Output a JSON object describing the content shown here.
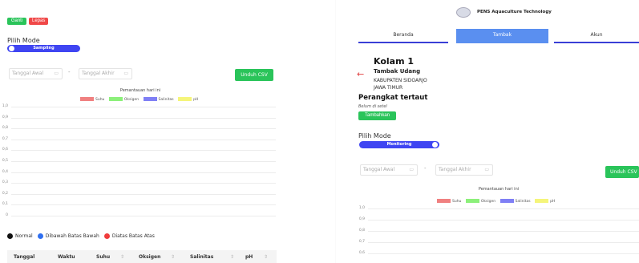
{
  "left": {
    "buttons": {
      "ganti": "Ganti",
      "lepas": "Lepas"
    },
    "mode_label": "Pilih Mode",
    "mode_toggle": "Sampling",
    "date_start": "Tanggal Awal",
    "date_end": "Tanggal Akhir",
    "date_dash": "-",
    "download_csv": "Unduh CSV",
    "chart_title": "Pemantauan hari ini",
    "legend": [
      {
        "label": "Suhu",
        "color": "#f08080"
      },
      {
        "label": "Oksigen",
        "color": "#8cf07a"
      },
      {
        "label": "Salinitas",
        "color": "#7f7ff5"
      },
      {
        "label": "pH",
        "color": "#f5f57a"
      }
    ],
    "yticks": [
      "1,0",
      "0,9",
      "0,8",
      "0,7",
      "0,6",
      "0,5",
      "0,4",
      "0,3",
      "0,2",
      "0,1",
      "0"
    ],
    "status_legend": [
      {
        "label": "Normal",
        "color": "#111111"
      },
      {
        "label": "Dibawah Batas Bawah",
        "color": "#2f6ff0"
      },
      {
        "label": "Diatas Batas Atas",
        "color": "#f03c3c"
      }
    ],
    "table_headers": [
      "Tanggal",
      "Waktu",
      "Suhu",
      "Oksigen",
      "Salinitas",
      "pH"
    ],
    "sort_icon": "⇕"
  },
  "right": {
    "brand": "PENS Aquaculture Technology",
    "tabs": [
      "Beranda",
      "Tambak",
      "Akun"
    ],
    "pond_title": "Kolam 1",
    "pond_name": "Tambak Udang",
    "regency": "KABUPATEN SIDOARJO",
    "province": "JAWA TIMUR",
    "device_title": "Perangkat tertaut",
    "device_none": "Belum di setel",
    "add_button": "Tambahkan",
    "mode_label": "Pilih Mode",
    "mode_toggle": "Monitoring",
    "date_start": "Tanggal Awal",
    "date_end": "Tanggal Akhir",
    "date_dash": "-",
    "download_csv": "Unduh CSV",
    "chart_title": "Pemantauan hari ini",
    "legend": [
      {
        "label": "Suhu",
        "color": "#f08080"
      },
      {
        "label": "Oksigen",
        "color": "#8cf07a"
      },
      {
        "label": "Salinitas",
        "color": "#7f7ff5"
      },
      {
        "label": "pH",
        "color": "#f5f57a"
      }
    ],
    "yticks": [
      "1,0",
      "0,9",
      "0,8",
      "0,7",
      "0,6"
    ]
  },
  "icons": {
    "calendar": "calendar-icon",
    "back": "arrow-left-icon",
    "logo": "logo-icon"
  },
  "colors": {
    "green": "#2ac45a",
    "red": "#f04848",
    "primary": "#3f45f2",
    "tab_active": "#5a8ff0"
  }
}
